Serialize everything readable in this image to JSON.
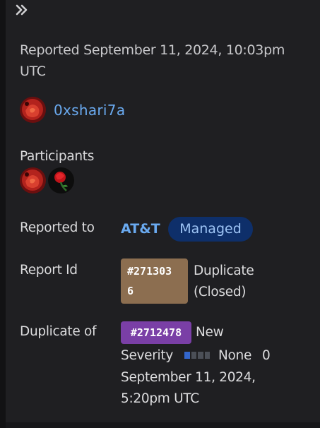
{
  "header": {
    "collapse_icon": "double-chevron-right-icon"
  },
  "report": {
    "reported_line1": "Reported September 11, 2024, 10:03pm",
    "reported_line2": "UTC",
    "reporter": "0xshari7a",
    "participants_label": "Participants",
    "reported_to_label": "Reported to",
    "reported_to_org": "AT&T",
    "managed_badge": "Managed",
    "report_id_label": "Report Id",
    "report_id_line1": "#271303",
    "report_id_line2": "6",
    "status_line1": "Duplicate",
    "status_line2": "(Closed)",
    "duplicate_of_label": "Duplicate of",
    "duplicate_id": "#2712478",
    "duplicate_state": "New",
    "severity_label": "Severity",
    "severity_value": "None",
    "severity_score": "0",
    "severity_level": 0.25,
    "duplicate_date_line1": "September 11, 2024,",
    "duplicate_date_line2": "5:20pm UTC"
  },
  "colors": {
    "link": "#6aaaf0",
    "managed_bg": "#0e2f6a",
    "report_badge_bg": "#8c6e50",
    "duplicate_badge_bg": "#7a3fa6",
    "severity_on": "#3366cc"
  }
}
